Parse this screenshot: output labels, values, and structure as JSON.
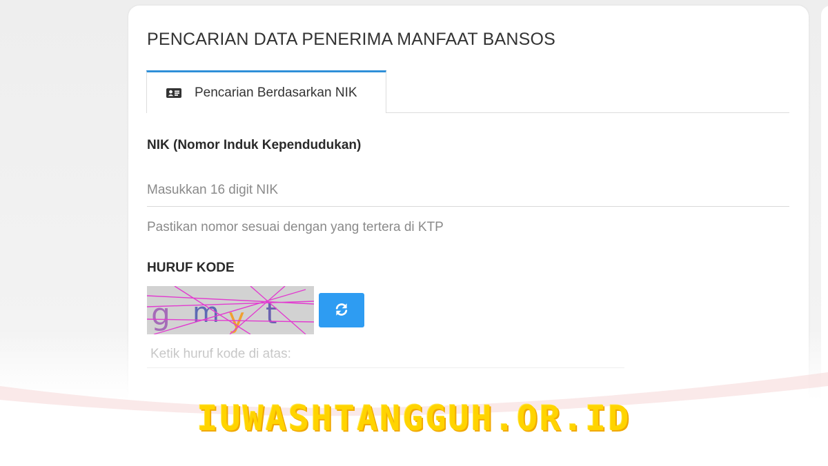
{
  "form": {
    "title": "PENCARIAN DATA PENERIMA MANFAAT BANSOS",
    "tab": {
      "label": "Pencarian Berdasarkan NIK",
      "icon": "id-card-icon",
      "accent_color": "#2f8fd8"
    },
    "nik_field": {
      "label": "NIK (Nomor Induk Kependudukan)",
      "placeholder": "Masukkan 16 digit NIK",
      "value": "",
      "help": "Pastikan nomor sesuai dengan yang tertera di KTP"
    },
    "captcha": {
      "label": "HURUF KODE",
      "code": "gmyt",
      "refresh_icon": "refresh-icon",
      "refresh_color": "#2e9cf2",
      "input_placeholder": "Ketik huruf kode di atas:",
      "input_value": ""
    }
  },
  "watermark": {
    "text": "IUWASHTANGGUH.OR.ID",
    "color": "#ffd400"
  }
}
